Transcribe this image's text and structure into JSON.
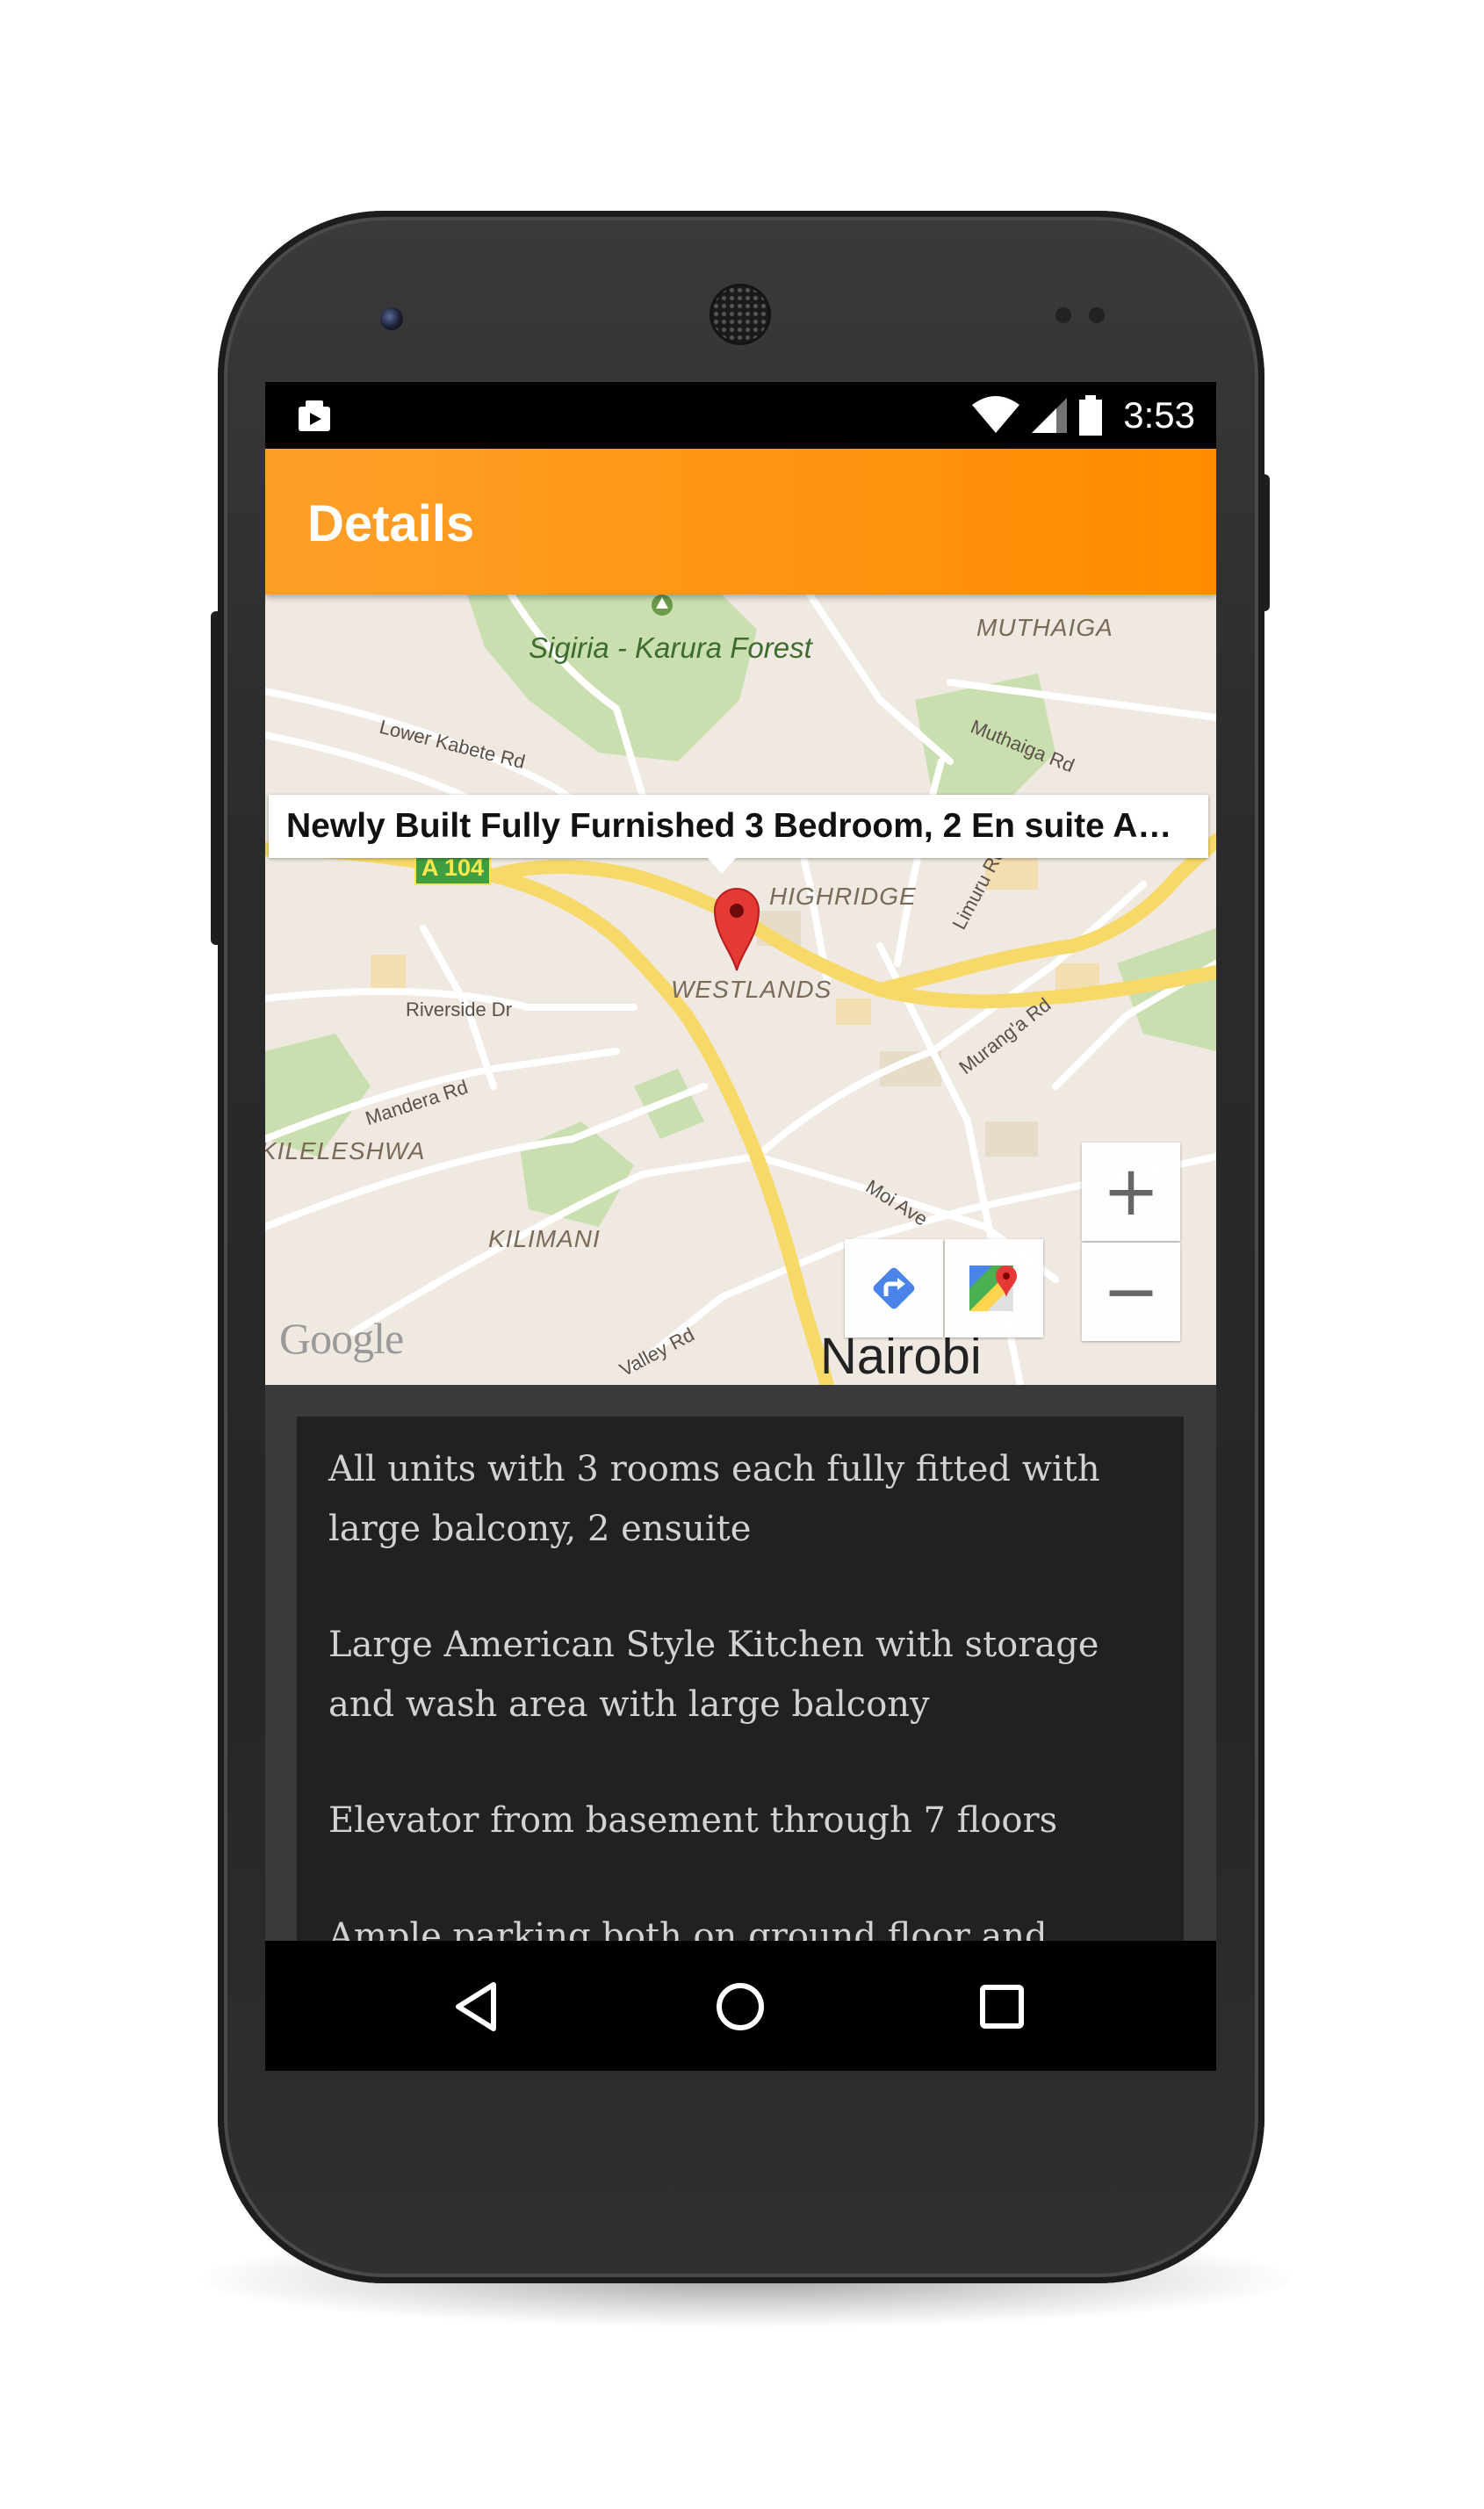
{
  "status_bar": {
    "time": "3:53",
    "icons": [
      "camera-roll-icon",
      "wifi-icon",
      "signal-icon",
      "battery-icon"
    ]
  },
  "app_bar": {
    "title": "Details",
    "color": "#ff8c00"
  },
  "map": {
    "info_window_title": "Newly Built Fully Furnished 3 Bedroom, 2 En suite Ap…",
    "labels": {
      "forest": "Sigiria - Karura Forest",
      "muthaiga": "MUTHAIGA",
      "lower_kabete": "Lower Kabete Rd",
      "muthaiga_rd": "Muthaiga Rd",
      "highridge": "HIGHRIDGE",
      "limuru_rd": "Limuru Rd",
      "westlands": "WESTLANDS",
      "riverside": "Riverside Dr",
      "muranga": "Murang'a Rd",
      "mandera": "Mandera Rd",
      "kileleshwa": "KILELESHWA",
      "kilimani": "KILIMANI",
      "moi_ave": "Moi Ave",
      "valley_rd": "Valley Rd",
      "nairobi": "Nairobi",
      "a104": "A 104"
    },
    "attribution": "Google",
    "zoom_in": "+",
    "zoom_out": "−"
  },
  "description": {
    "paragraphs": [
      "All units with 3 rooms each fully fitted with large balcony, 2 ensuite",
      "Large American Style Kitchen with storage and wash area with large balcony",
      "Elevator from basement through 7 floors",
      "Ample parking both on ground floor and"
    ]
  }
}
